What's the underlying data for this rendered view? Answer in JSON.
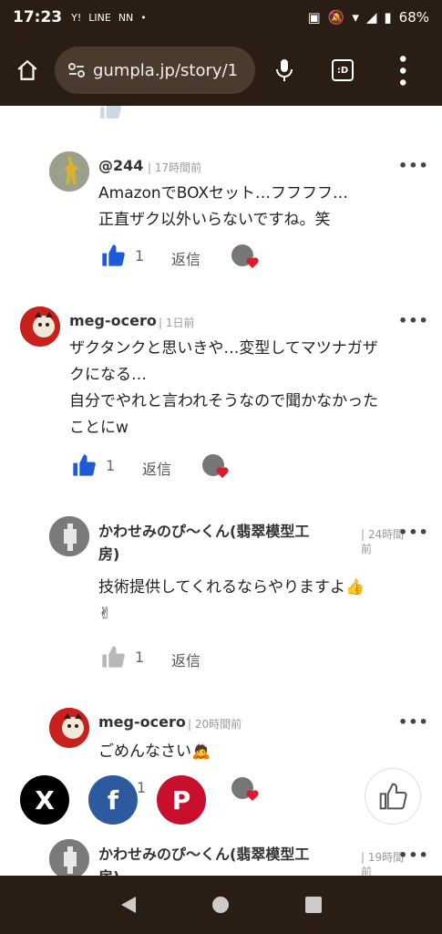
{
  "status": {
    "time": "17:23",
    "icons": [
      "Y!",
      "LINE",
      "NN"
    ],
    "battery": "68%"
  },
  "browser": {
    "url": "gumpla.jp/story/1",
    "tabs_label": ":D"
  },
  "comments": [
    {
      "user": "@244",
      "time": "17時間前",
      "lines": [
        "AmazonでBOXセット…フフフフ…",
        "正直ザク以外いらないですね。笑"
      ],
      "likes": "1",
      "reply": "返信"
    },
    {
      "user": "meg-ocero",
      "time": "1日前",
      "lines": [
        "ザクタンクと思いきや…変型してマツナガザ",
        "クになる…",
        "自分でやれと言われそうなので聞かなかった",
        "ことにw"
      ],
      "likes": "1",
      "reply": "返信"
    },
    {
      "user_lines": [
        "かわせみのぴ〜くん(翡翠模型工",
        "房)"
      ],
      "time_lines": [
        "24時間",
        "前"
      ],
      "lines": [
        "技術提供してくれるならやりますよ👍",
        "✌"
      ],
      "likes": "1",
      "reply": "返信"
    },
    {
      "user": "meg-ocero",
      "time": "20時間前",
      "lines": [
        "ごめんなさい🙇"
      ],
      "likes": "1"
    },
    {
      "user_lines": [
        "かわせみのぴ〜くん(翡翠模型工",
        "房)"
      ],
      "time_lines": [
        "19時間",
        "前"
      ]
    }
  ],
  "share": [
    "X",
    "f",
    "P"
  ],
  "colors": {
    "like_blue": "#1e5bd6",
    "like_gray": "#aaaaaa",
    "dark_bar": "#2a1d14"
  }
}
